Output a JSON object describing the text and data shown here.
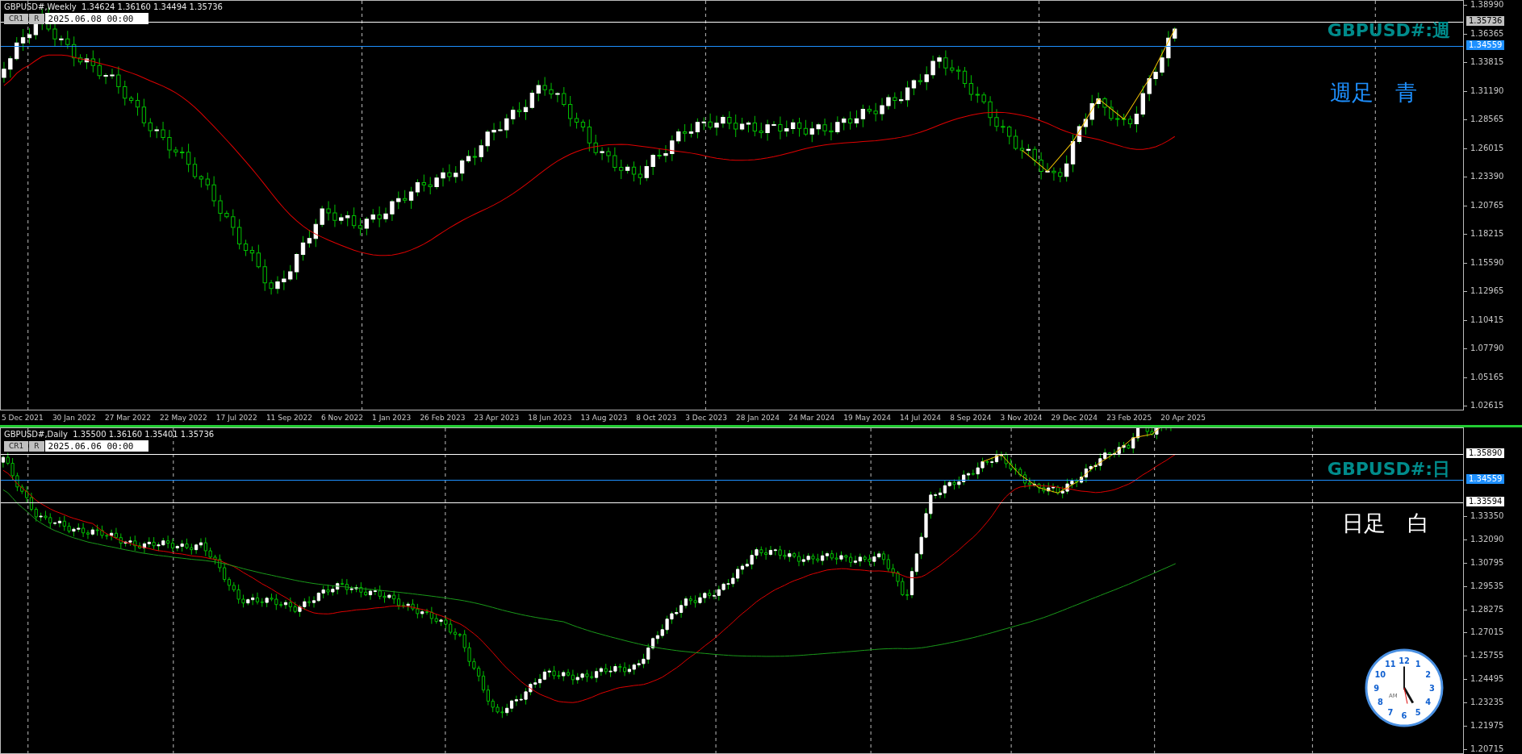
{
  "top_chart": {
    "header": "GBPUSD#,Weekly  1.34624 1.36160 1.34494 1.35736",
    "buttons": [
      "CR1",
      "R"
    ],
    "date_field": "2025.06.08 00:00",
    "symbol_label": "GBPUSD#:週",
    "note": "週足　青",
    "price_ticks": [
      "1.38990",
      "1.36365",
      "1.33815",
      "1.31190",
      "1.28565",
      "1.26015",
      "1.23390",
      "1.20765",
      "1.18215",
      "1.15590",
      "1.12965",
      "1.10415",
      "1.07790",
      "1.05165",
      "1.02615"
    ],
    "price_tags": [
      {
        "text": "1.35736",
        "kind": "bid"
      },
      {
        "text": "1.34559",
        "kind": "line"
      }
    ],
    "time_labels": [
      "5 Dec 2021",
      "30 Jan 2022",
      "27 Mar 2022",
      "22 May 2022",
      "17 Jul 2022",
      "11 Sep 2022",
      "6 Nov 2022",
      "1 Jan 2023",
      "26 Feb 2023",
      "23 Apr 2023",
      "18 Jun 2023",
      "13 Aug 2023",
      "8 Oct 2023",
      "3 Dec 2023",
      "28 Jan 2024",
      "24 Mar 2024",
      "19 May 2024",
      "14 Jul 2024",
      "8 Sep 2024",
      "3 Nov 2024",
      "29 Dec 2024",
      "23 Feb 2025",
      "20 Apr 2025"
    ]
  },
  "bottom_chart": {
    "header": "GBPUSD#,Daily  1.35500 1.36160 1.35401 1.35736",
    "buttons": [
      "CR1",
      "R"
    ],
    "date_field": "2025.06.06 00:00",
    "symbol_label": "GBPUSD#:日",
    "note": "日足　白",
    "price_ticks": [
      "1.33350",
      "1.32090",
      "1.30795",
      "1.29535",
      "1.28275",
      "1.27015",
      "1.25755",
      "1.24495",
      "1.23235",
      "1.21975",
      "1.20715"
    ],
    "price_tags": [
      {
        "text": "1.35890",
        "kind": "level"
      },
      {
        "text": "1.34559",
        "kind": "line"
      },
      {
        "text": "1.33594",
        "kind": "level"
      }
    ],
    "clock": {
      "numerals": [
        "12",
        "1",
        "2",
        "3",
        "4",
        "5",
        "6",
        "7",
        "8",
        "9",
        "10",
        "11"
      ],
      "period": "AM"
    }
  }
}
